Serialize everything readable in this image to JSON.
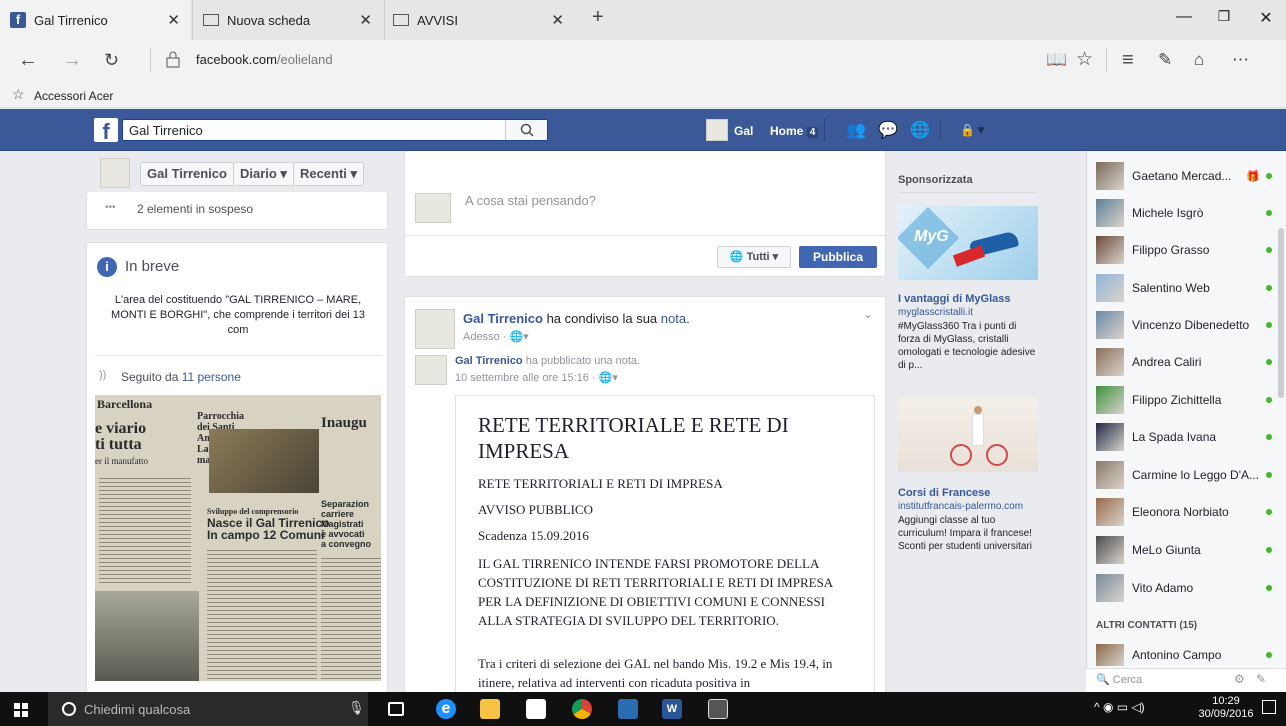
{
  "browser": {
    "tabs": [
      {
        "label": "Gal Tirrenico",
        "active": true,
        "icon": "facebook-icon"
      },
      {
        "label": "Nuova scheda",
        "active": false,
        "icon": "newtab-icon"
      },
      {
        "label": "AVVISI",
        "active": false,
        "icon": "page-icon"
      }
    ],
    "add_tab": "+",
    "url_domain": "facebook.com",
    "url_path": "/eolieland",
    "favorites_label": "Accessori Acer"
  },
  "fb": {
    "search_value": "Gal Tirrenico",
    "profile_name": "Gal",
    "home_label": "Home",
    "home_count": "4"
  },
  "left": {
    "page_name": "Gal Tirrenico",
    "diario": "Diario",
    "recenti": "Recenti",
    "pending": "2 elementi in sospeso",
    "inbreve_title": "In breve",
    "inbreve_text": "L'area del costituendo \"GAL TIRRENICO – MARE, MONTI E BORGHI\", che comprende i territori dei 13 com",
    "followed_prefix": "Seguito da ",
    "followed_link": "11 persone",
    "newspaper": {
      "masthead": "Barcellona",
      "headline1": "e viario",
      "headline2": "ti tutta",
      "headline3": "er il manufatto",
      "mid1": "Parrocchia",
      "mid2": "dei Santi",
      "mid3": "Andrea e Vito",
      "mid4": "La Settimana",
      "mid5": "mariana",
      "sub": "Sviluppo del comprensorio",
      "main1": "Nasce il Gal Tirrenico",
      "main2": "In campo 12 Comuni",
      "right1": "Inaugu",
      "right2": "Separazion",
      "right3": "carriere",
      "right4": "Magistrati",
      "right5": "e avvocati",
      "right6": "a convegno"
    }
  },
  "composer": {
    "placeholder": "A cosa stai pensando?",
    "audience": "Tutti",
    "publish": "Pubblica"
  },
  "post": {
    "author": "Gal Tirrenico",
    "action_pre": " ha condiviso la sua ",
    "action_link": "nota",
    "action_post": ".",
    "time": "Adesso",
    "inner_author": "Gal Tirrenico",
    "inner_action": " ha pubblicato una nota.",
    "inner_time": "10 settembre alle ore 15:16",
    "note_title": "RETE TERRITORIALE E RETE DI IMPRESA",
    "note_sub": "RETE TERRITORIALI E RETI DI IMPRESA",
    "note_avviso": "AVVISO PUBBLICO",
    "note_scadenza": "Scadenza 15.09.2016",
    "note_para1": "IL GAL TIRRENICO INTENDE FARSI PROMOTORE DELLA COSTITUZIONE DI RETI TERRITORIALI E RETI DI IMPRESA PER LA DEFINIZIONE DI OBIETTIVI COMUNI E CONNESSI ALLA STRATEGIA DI SVILUPPO DEL TERRITORIO.",
    "note_para2": "Tra i criteri di selezione dei GAL nel bando Mis. 19.2 e Mis 19.4, in itinere, relativa ad interventi con ricaduta positiva in"
  },
  "ads": {
    "header": "Sponsorizzata",
    "items": [
      {
        "title": "I vantaggi di MyGlass",
        "domain": "myglasscristalli.it",
        "text": "#MyGlass360 Tra i punti di forza di MyGlass, cristalli omologati e tecnologie adesive di p...",
        "brand": "MyG"
      },
      {
        "title": "Corsi di Francese",
        "domain": "institutfrancais-palermo.com",
        "text": "Aggiungi classe al tuo curriculum! Impara il francese! Sconti per studenti universitari"
      }
    ]
  },
  "chat": {
    "contacts": [
      {
        "name": "Gaetano Mercad...",
        "gift": true
      },
      {
        "name": "Michele Isgrò"
      },
      {
        "name": "Filippo Grasso"
      },
      {
        "name": "Salentino Web"
      },
      {
        "name": "Vincenzo Dibenedetto"
      },
      {
        "name": "Andrea Caliri"
      },
      {
        "name": "Filippo Zichittella"
      },
      {
        "name": "La Spada Ivana"
      },
      {
        "name": "Carmine lo Leggo D'A..."
      },
      {
        "name": "Eleonora Norbiato"
      },
      {
        "name": "MeLo Giunta"
      },
      {
        "name": "Vito Adamo"
      }
    ],
    "other_header": "ALTRI CONTATTI (15)",
    "other": [
      {
        "name": "Antonino Campo"
      }
    ],
    "search_placeholder": "Cerca"
  },
  "taskbar": {
    "search_placeholder": "Chiedimi qualcosa",
    "time": "10:29",
    "date": "30/09/2016"
  },
  "colors": {
    "fb_blue": "#3b5998",
    "online": "#42b72a",
    "publish": "#4267b2"
  }
}
